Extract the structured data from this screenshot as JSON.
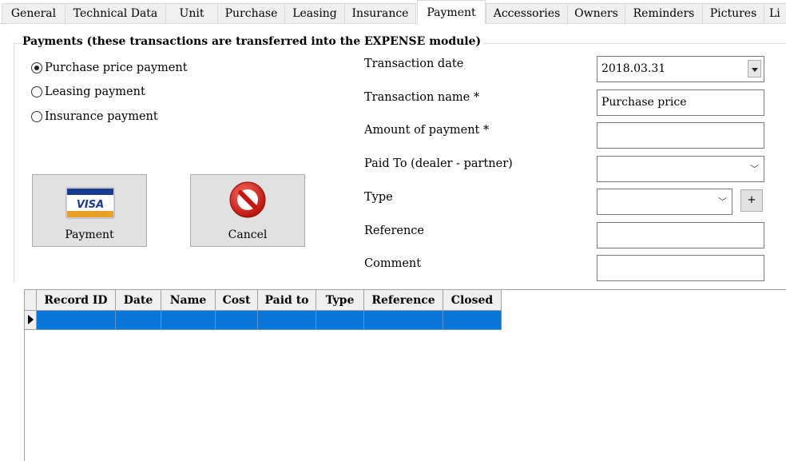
{
  "tabs": [
    {
      "label": "General",
      "active": false
    },
    {
      "label": "Technical Data",
      "active": false
    },
    {
      "label": "Unit",
      "active": false
    },
    {
      "label": "Purchase",
      "active": false
    },
    {
      "label": "Leasing",
      "active": false
    },
    {
      "label": "Insurance",
      "active": false
    },
    {
      "label": "Payment",
      "active": true
    },
    {
      "label": "Accessories",
      "active": false
    },
    {
      "label": "Owners",
      "active": false
    },
    {
      "label": "Reminders",
      "active": false
    },
    {
      "label": "Pictures",
      "active": false
    },
    {
      "label": "Li",
      "active": false
    }
  ],
  "group": {
    "title": "Payments (these transactions are transferred into the EXPENSE module)"
  },
  "payment_options": [
    {
      "label": "Purchase price payment",
      "checked": true
    },
    {
      "label": "Leasing payment",
      "checked": false
    },
    {
      "label": "Insurance payment",
      "checked": false
    }
  ],
  "buttons": {
    "payment": {
      "label": "Payment",
      "icon": "visa-card-icon"
    },
    "cancel": {
      "label": "Cancel",
      "icon": "no-entry-icon"
    }
  },
  "form": {
    "transaction_date": {
      "label": "Transaction date",
      "value": "2018.03.31"
    },
    "transaction_name": {
      "label": "Transaction name *",
      "value": "Purchase price"
    },
    "amount": {
      "label": "Amount of payment *",
      "value": ""
    },
    "paid_to": {
      "label": "Paid To (dealer - partner)",
      "value": ""
    },
    "type": {
      "label": "Type",
      "value": "",
      "add_label": "+"
    },
    "reference": {
      "label": "Reference",
      "value": ""
    },
    "comment": {
      "label": "Comment",
      "value": ""
    }
  },
  "grid": {
    "columns": [
      "Record ID",
      "Date",
      "Name",
      "Cost",
      "Paid to",
      "Type",
      "Reference",
      "Closed"
    ],
    "selected_row_color": "#0a77d8"
  },
  "visa_text": "VISA"
}
